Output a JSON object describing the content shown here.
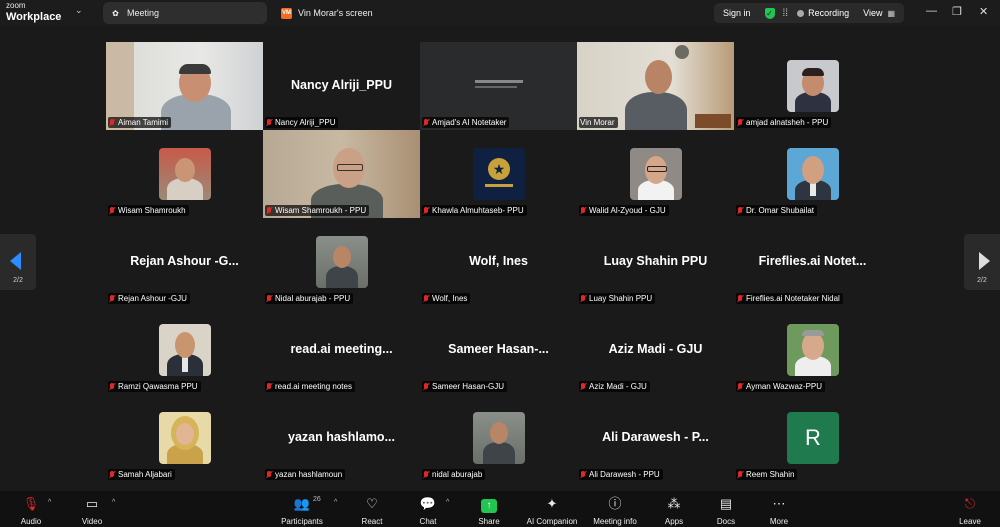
{
  "app": {
    "brand_line1": "zoom",
    "brand_line2": "Workplace"
  },
  "tabs": [
    {
      "label": "Meeting",
      "icon": "zoom-paw-icon"
    },
    {
      "label": "Vin Morar's screen",
      "icon": "screen-share-icon"
    }
  ],
  "header": {
    "signin": "Sign in",
    "recording": "Recording",
    "view": "View"
  },
  "pagination": {
    "left": "2/2",
    "right": "2/2"
  },
  "participants": [
    {
      "big": "",
      "label": "Aiman Tamimi",
      "kind": "video"
    },
    {
      "big": "Nancy Alriji_PPU",
      "label": "Nancy Alriji_PPU",
      "kind": "name"
    },
    {
      "big": "",
      "label": "Amjad's AI Notetaker",
      "kind": "notetaker"
    },
    {
      "big": "",
      "label": "Vin Morar",
      "kind": "video",
      "active": true
    },
    {
      "big": "",
      "label": "amjad alnatsheh - PPU",
      "kind": "avatar"
    },
    {
      "big": "",
      "label": "Wisam Shamroukh",
      "kind": "avatar"
    },
    {
      "big": "",
      "label": "Wisam Shamroukh - PPU",
      "kind": "video"
    },
    {
      "big": "",
      "label": "Khawla Almuhtaseb- PPU",
      "kind": "avatar"
    },
    {
      "big": "",
      "label": "Walid Al-Zyoud - GJU",
      "kind": "avatar"
    },
    {
      "big": "",
      "label": "Dr. Omar Shubailat",
      "kind": "avatar"
    },
    {
      "big": "Rejan Ashour -G...",
      "label": "Rejan Ashour -GJU",
      "kind": "name"
    },
    {
      "big": "",
      "label": "Nidal aburajab - PPU",
      "kind": "avatar"
    },
    {
      "big": "Wolf, Ines",
      "label": "Wolf, Ines",
      "kind": "name"
    },
    {
      "big": "Luay Shahin PPU",
      "label": "Luay Shahin PPU",
      "kind": "name"
    },
    {
      "big": "Fireflies.ai Notet...",
      "label": "Fireflies.ai Notetaker Nidal",
      "kind": "name"
    },
    {
      "big": "",
      "label": "Ramzi Qawasma PPU",
      "kind": "avatar"
    },
    {
      "big": "read.ai meeting...",
      "label": "read.ai meeting notes",
      "kind": "name"
    },
    {
      "big": "Sameer Hasan-...",
      "label": "Sameer Hasan-GJU",
      "kind": "name"
    },
    {
      "big": "Aziz Madi - GJU",
      "label": "Aziz Madi - GJU",
      "kind": "name"
    },
    {
      "big": "",
      "label": "Ayman Wazwaz-PPU",
      "kind": "avatar"
    },
    {
      "big": "",
      "label": "Samah Aljabari",
      "kind": "avatar"
    },
    {
      "big": "yazan hashlamo...",
      "label": "yazan hashlamoun",
      "kind": "name"
    },
    {
      "big": "",
      "label": "nidal aburajab",
      "kind": "avatar"
    },
    {
      "big": "Ali Darawesh - P...",
      "label": "Ali Darawesh - PPU",
      "kind": "name"
    },
    {
      "big": "",
      "label": "Reem Shahin",
      "kind": "initial",
      "initial": "R"
    }
  ],
  "toolbar": {
    "audio": "Audio",
    "video": "Video",
    "participants": "Participants",
    "participants_count": "26",
    "react": "React",
    "chat": "Chat",
    "share": "Share",
    "ai_companion": "AI Companion",
    "meeting_info": "Meeting info",
    "apps": "Apps",
    "docs": "Docs",
    "more": "More",
    "leave": "Leave"
  },
  "colors": {
    "active_speaker": "#23c552",
    "muted": "#e02828",
    "accent": "#2d8cff",
    "reem_avatar": "#1f7a4d"
  }
}
